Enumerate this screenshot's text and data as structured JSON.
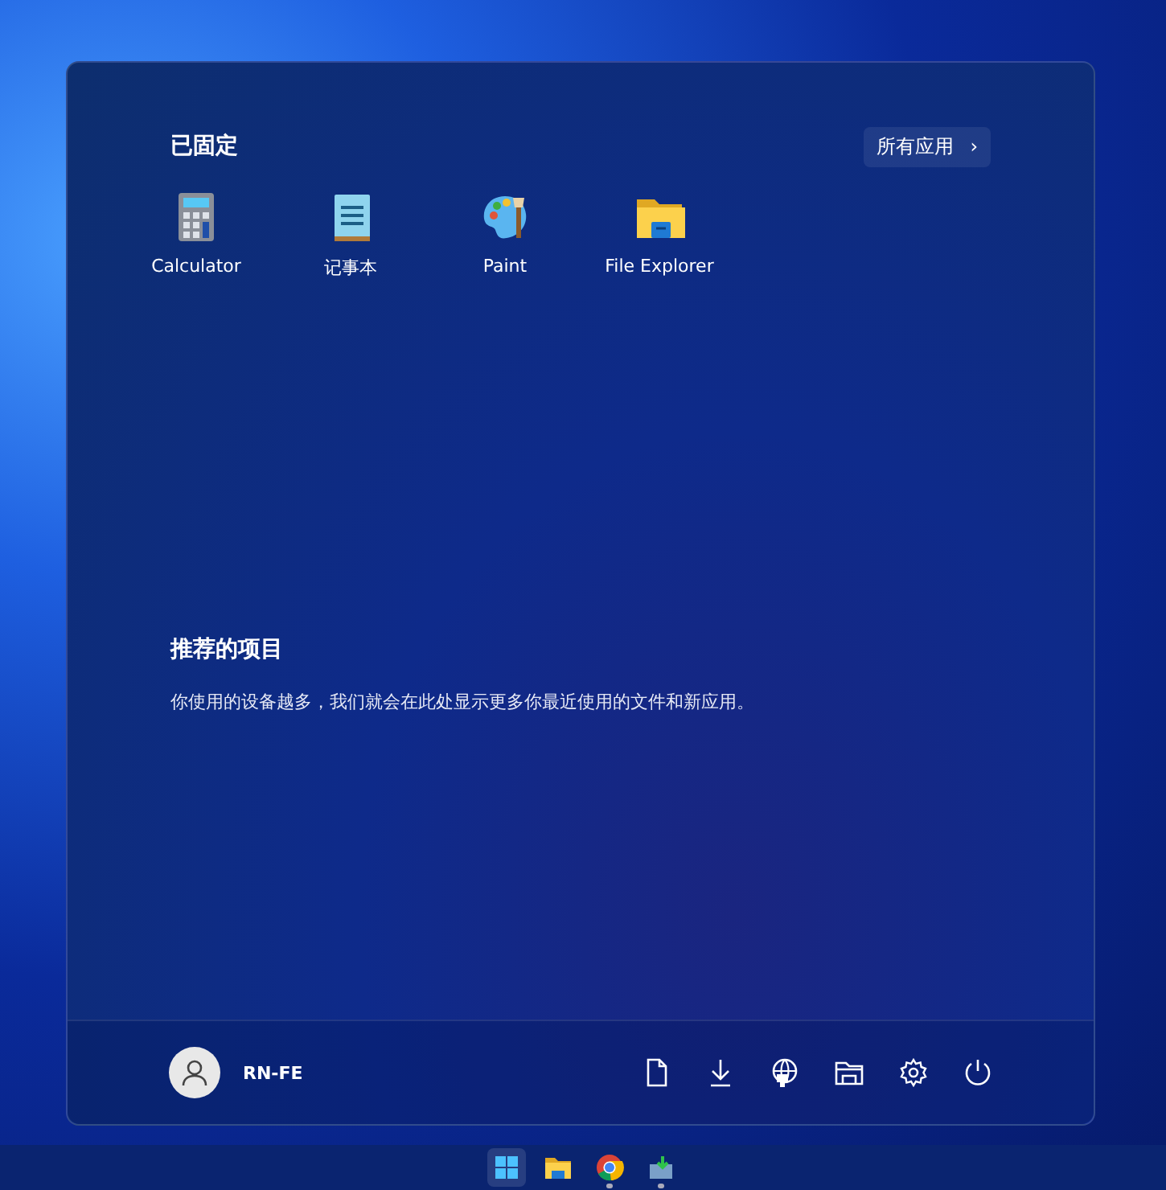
{
  "start_menu": {
    "pinned_title": "已固定",
    "all_apps_button": {
      "label": "所有应用",
      "arrow": "›"
    },
    "pinned_apps": [
      {
        "kind": "calculator",
        "label": "Calculator"
      },
      {
        "kind": "notepad",
        "label": "记事本"
      },
      {
        "kind": "paint",
        "label": "Paint"
      },
      {
        "kind": "explorer",
        "label": "File Explorer"
      }
    ],
    "recommended_title": "推荐的项目",
    "recommended_text": "你使用的设备越多，我们就会在此处显示更多你最近使用的文件和新应用。",
    "user": {
      "name": "RN-FE"
    },
    "footer_icons": [
      {
        "kind": "document"
      },
      {
        "kind": "download"
      },
      {
        "kind": "network"
      },
      {
        "kind": "folder"
      },
      {
        "kind": "settings"
      },
      {
        "kind": "power"
      }
    ]
  },
  "taskbar": [
    {
      "kind": "start",
      "selected": true,
      "running": false
    },
    {
      "kind": "explorer",
      "selected": false,
      "running": false
    },
    {
      "kind": "chrome",
      "selected": false,
      "running": true
    },
    {
      "kind": "app",
      "selected": false,
      "running": true
    }
  ]
}
